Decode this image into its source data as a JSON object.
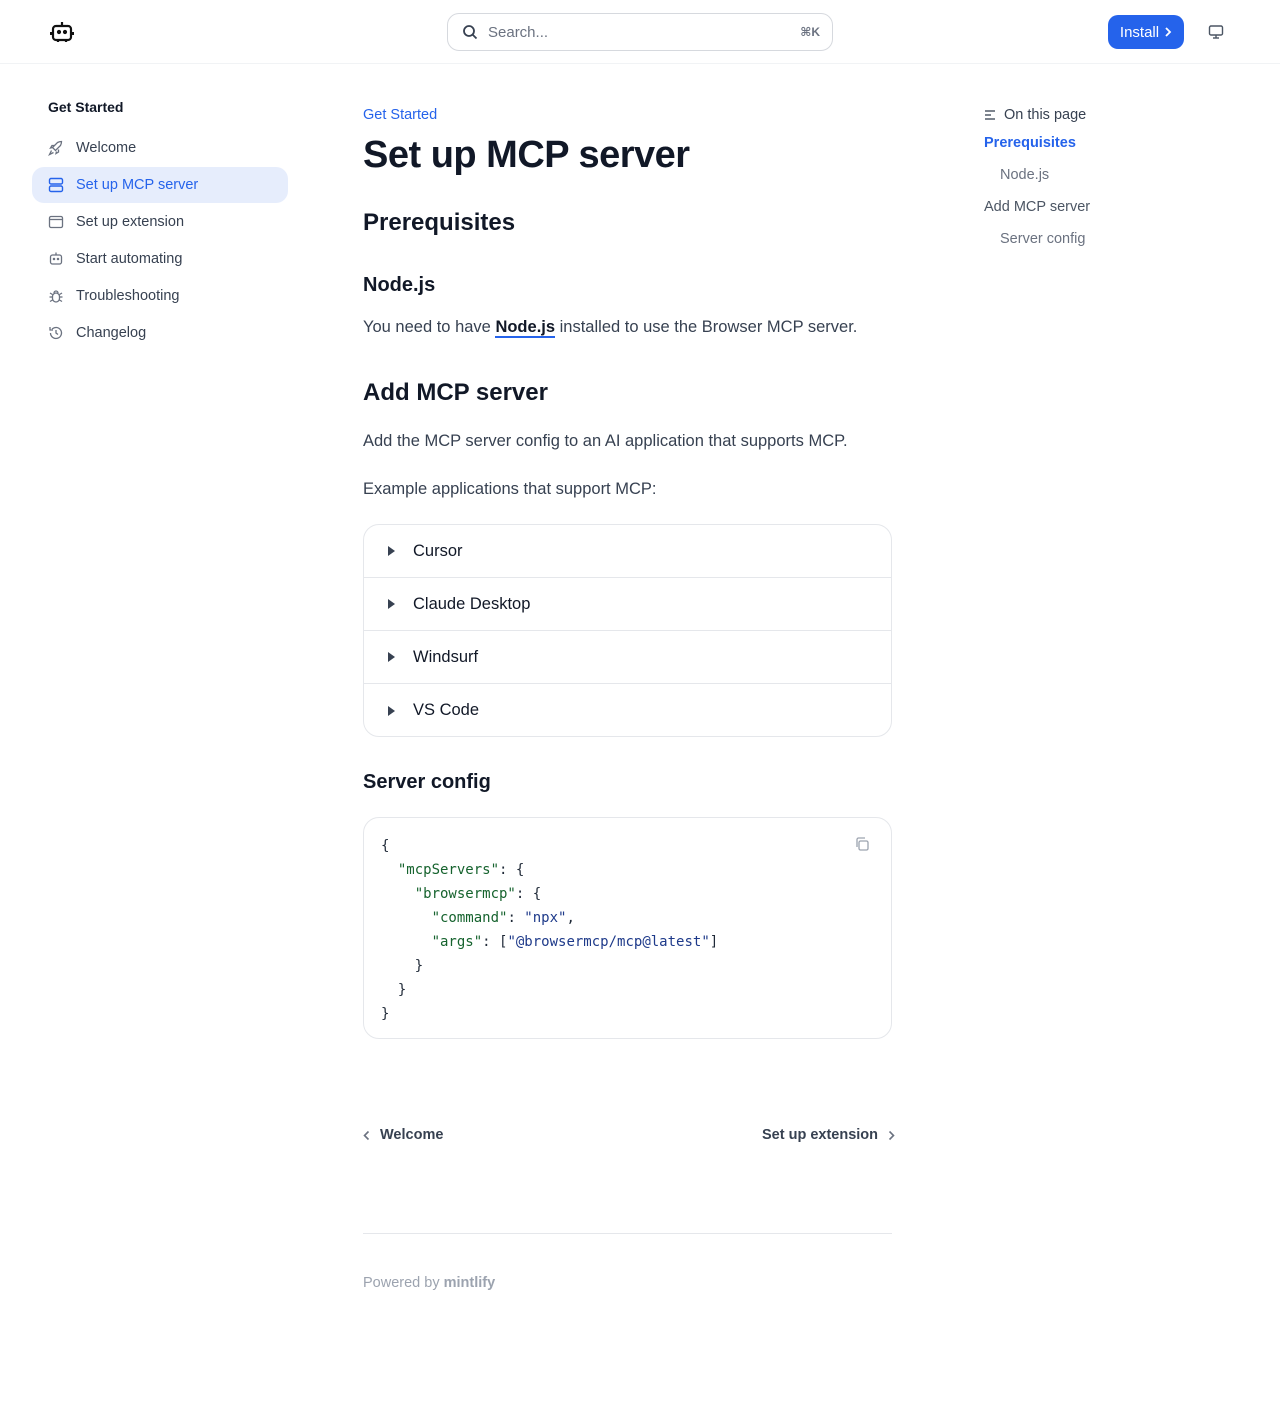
{
  "header": {
    "search_placeholder": "Search...",
    "shortcut": "⌘K",
    "install_label": "Install"
  },
  "sidebar": {
    "title": "Get Started",
    "items": [
      {
        "label": "Welcome",
        "icon": "rocket-icon"
      },
      {
        "label": "Set up MCP server",
        "icon": "server-icon",
        "active": true
      },
      {
        "label": "Set up extension",
        "icon": "browser-window-icon"
      },
      {
        "label": "Start automating",
        "icon": "robot-icon"
      },
      {
        "label": "Troubleshooting",
        "icon": "bug-icon"
      },
      {
        "label": "Changelog",
        "icon": "history-icon"
      }
    ]
  },
  "main": {
    "breadcrumb": "Get Started",
    "title": "Set up MCP server",
    "prereq_heading": "Prerequisites",
    "node_heading": "Node.js",
    "node_text_before": "You need to have ",
    "node_link": "Node.js",
    "node_text_after": " installed to use the Browser MCP server.",
    "add_heading": "Add MCP server",
    "add_text": "Add the MCP server config to an AI application that supports MCP.",
    "example_text": "Example applications that support MCP:",
    "accordion": [
      "Cursor",
      "Claude Desktop",
      "Windsurf",
      "VS Code"
    ],
    "config_heading": "Server config",
    "code": {
      "open": "{",
      "mcp_key": "\"mcpServers\"",
      "browser_key": "\"browsermcp\"",
      "command_key": "\"command\"",
      "command_val": "\"npx\"",
      "args_key": "\"args\"",
      "args_val": "\"@browsermcp/mcp@latest\"",
      "close": "}"
    },
    "prev_label": "Welcome",
    "next_label": "Set up extension",
    "powered_by": "Powered by",
    "powered_brand": "mintlify"
  },
  "toc": {
    "heading": "On this page",
    "items": [
      {
        "label": "Prerequisites",
        "active": true
      },
      {
        "label": "Node.js"
      },
      {
        "label": "Add MCP server"
      },
      {
        "label": "Server config"
      }
    ]
  },
  "colors": {
    "accent": "#2563eb",
    "active_bg": "#e6edfc",
    "code_key": "#16632e",
    "code_string": "#1e3a8a"
  }
}
